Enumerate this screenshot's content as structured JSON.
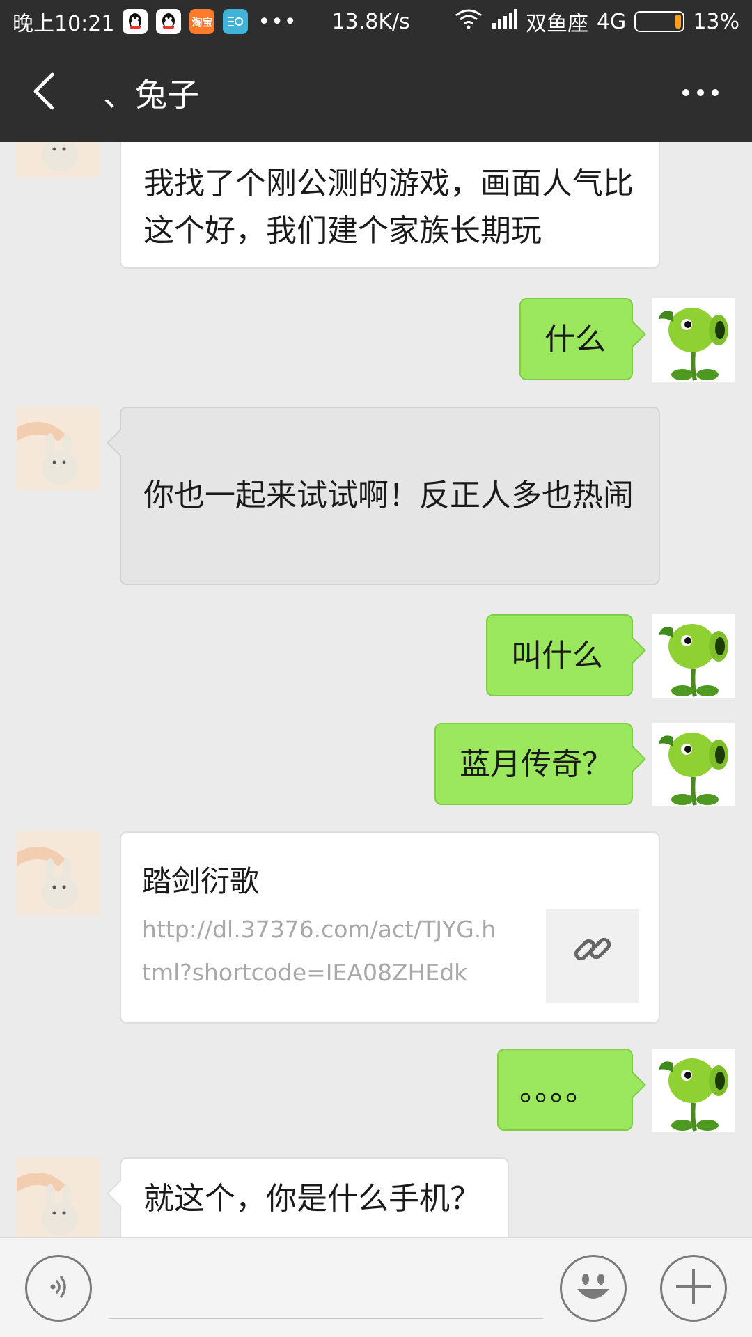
{
  "status_bar": {
    "time": "晚上10:21",
    "app_icons": [
      "qq-icon",
      "qq-icon",
      "taobao-icon",
      "file-manager-icon"
    ],
    "taobao_label": "淘宝",
    "more": "•••",
    "net_speed": "13.8K/s",
    "carrier": "双鱼座",
    "network_type": "4G",
    "battery_percent": "13%",
    "battery_level": 0.13
  },
  "nav": {
    "back_icon": "chevron-left-icon",
    "title": "、兔子",
    "more_icon": "more-dots-icon"
  },
  "messages": [
    {
      "side": "in",
      "text": "我找了个刚公测的游戏，画面人气比这个好，我们建个家族长期玩"
    },
    {
      "side": "out",
      "text": "什么"
    },
    {
      "side": "in",
      "text": "你也一起来试试啊！反正人多也热闹",
      "state": "pressed"
    },
    {
      "side": "out",
      "text": "叫什么"
    },
    {
      "side": "out",
      "text": "蓝月传奇？"
    },
    {
      "side": "in",
      "type": "link",
      "title": "踏剑衍歌",
      "url": "http://dl.37376.com/act/TJYG.html?shortcode=IEA08ZHEdk",
      "thumb_icon": "link-icon"
    },
    {
      "side": "out",
      "text": "。。。。"
    },
    {
      "side": "in",
      "text": "就这个，你是什么手机？"
    }
  ],
  "input_bar": {
    "voice_icon": "voice-icon",
    "text_value": "",
    "emoji_icon": "emoji-icon",
    "plus_icon": "plus-icon"
  },
  "colors": {
    "header_bg": "#2e2e2e",
    "chat_bg": "#ebebeb",
    "outgoing_bubble": "#9be85e",
    "incoming_bubble": "#ffffff",
    "battery_accent": "#ff9f1c"
  }
}
